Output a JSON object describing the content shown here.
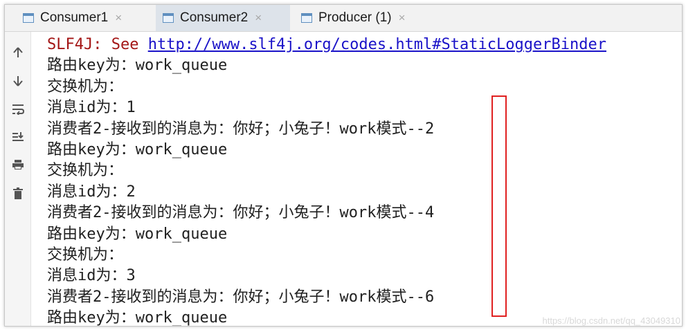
{
  "tabs": [
    {
      "label": "Consumer1",
      "selected": false
    },
    {
      "label": "Consumer2",
      "selected": true
    },
    {
      "label": "Producer (1)",
      "selected": false
    }
  ],
  "tab_close_glyph": "×",
  "gutter_icons": [
    "arrow-up-icon",
    "arrow-down-icon",
    "soft-wrap-icon",
    "scroll-to-end-icon",
    "print-icon",
    "trash-icon"
  ],
  "console": {
    "slf4j_prefix": "SLF4J: See ",
    "slf4j_link": "http://www.slf4j.org/codes.html#StaticLoggerBinder",
    "lines": [
      "路由key为：work_queue",
      "交换机为：",
      "消息id为：1",
      "消费者2-接收到的消息为：你好；小兔子！work模式--2",
      "路由key为：work_queue",
      "交换机为：",
      "消息id为：2",
      "消费者2-接收到的消息为：你好；小兔子！work模式--4",
      "路由key为：work_queue",
      "交换机为：",
      "消息id为：3",
      "消费者2-接收到的消息为：你好；小兔子！work模式--6",
      "路由key为：work_queue"
    ]
  },
  "watermark": "https://blog.csdn.net/qq_43049310",
  "colors": {
    "error_text": "#a31515",
    "link": "#1a12c8",
    "highlight_box": "#e02020"
  }
}
